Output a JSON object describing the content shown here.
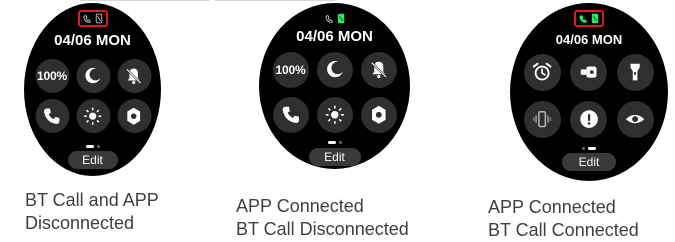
{
  "watches": [
    {
      "id": "bt-call-and-app-disconnected",
      "date": "04/06",
      "day": "MON",
      "status": {
        "bt_call": "disconnected",
        "app": "disconnected"
      },
      "tiles_row1": [
        {
          "label": "100%"
        },
        {
          "icon": "moon-icon"
        },
        {
          "icon": "bell-off-icon"
        }
      ],
      "tiles_row2": [
        {
          "icon": "phone-icon"
        },
        {
          "icon": "brightness-icon"
        },
        {
          "icon": "gear-icon"
        }
      ],
      "edit_label": "Edit",
      "caption_line1": "BT Call and APP",
      "caption_line2": "Disconnected"
    },
    {
      "id": "app-connected-bt-call-disconnected",
      "date": "04/06",
      "day": "MON",
      "status": {
        "bt_call": "disconnected",
        "app": "connected"
      },
      "tiles_row1": [
        {
          "label": "100%"
        },
        {
          "icon": "moon-icon"
        },
        {
          "icon": "bell-off-icon"
        }
      ],
      "tiles_row2": [
        {
          "icon": "phone-icon"
        },
        {
          "icon": "brightness-icon"
        },
        {
          "icon": "gear-icon"
        }
      ],
      "edit_label": "Edit",
      "caption_line1": "APP Connected",
      "caption_line2": "BT Call Disconnected"
    },
    {
      "id": "app-connected-bt-call-connected",
      "date": "04/06",
      "day": "MON",
      "status": {
        "bt_call": "connected",
        "app": "connected"
      },
      "tiles_row1": [
        {
          "icon": "alarm-icon"
        },
        {
          "icon": "find-phone-icon"
        },
        {
          "icon": "flashlight-icon"
        }
      ],
      "tiles_row2": [
        {
          "icon": "vibration-icon"
        },
        {
          "icon": "alert-icon"
        },
        {
          "icon": "eye-icon"
        }
      ],
      "edit_label": "Edit",
      "caption_line1": "APP Connected",
      "caption_line2": "BT Call Connected"
    }
  ],
  "colors": {
    "background": "#ffffff",
    "watch_face": "#000000",
    "tile": "#2f2f2f",
    "edit_button": "#3a3a3a",
    "highlight": "#e01b1b",
    "connected_icon": "#2ee55f",
    "disconnected_icon": "#d7d7d7",
    "caption_text": "#3f3f3f"
  }
}
